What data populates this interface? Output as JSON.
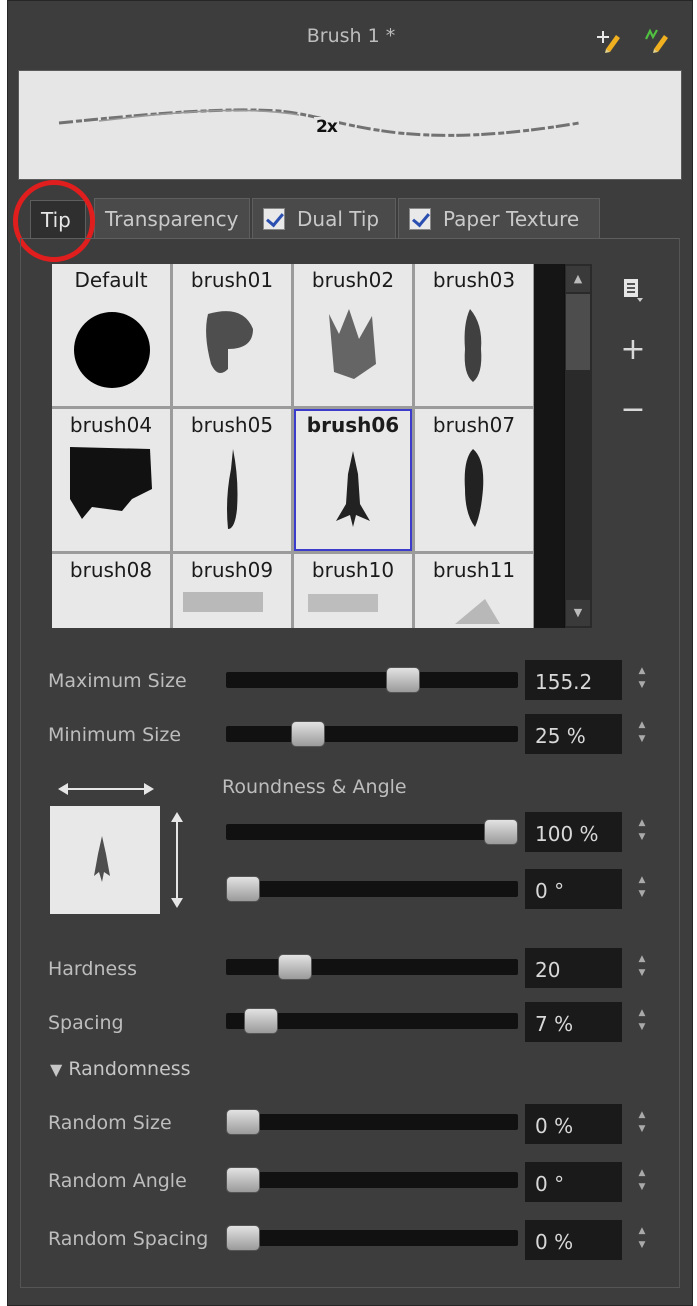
{
  "header": {
    "title": "Brush 1 *",
    "icons": [
      "new-brush-icon",
      "new-brush-variant-icon"
    ]
  },
  "preview": {
    "badge": "2x"
  },
  "tabs": [
    {
      "label": "Tip",
      "active": true
    },
    {
      "label": "Transparency",
      "active": false
    },
    {
      "label": "Dual Tip",
      "checked": true
    },
    {
      "label": "Paper Texture",
      "checked": true
    }
  ],
  "brushes": [
    {
      "name": "Default"
    },
    {
      "name": "brush01"
    },
    {
      "name": "brush02"
    },
    {
      "name": "brush03"
    },
    {
      "name": "brush04"
    },
    {
      "name": "brush05"
    },
    {
      "name": "brush06",
      "selected": true
    },
    {
      "name": "brush07"
    },
    {
      "name": "brush08"
    },
    {
      "name": "brush09"
    },
    {
      "name": "brush10"
    },
    {
      "name": "brush11"
    }
  ],
  "side_buttons": {
    "menu": "menu-icon",
    "add": "+",
    "remove": "−"
  },
  "sliders": {
    "max_size": {
      "label": "Maximum Size",
      "value": "155.2",
      "level": 0.62
    },
    "min_size": {
      "label": "Minimum Size",
      "value": "25 %",
      "level": 0.25
    },
    "roundness": {
      "value": "100 %",
      "level": 1.0
    },
    "angle": {
      "value": "0 °",
      "level": 0.0
    },
    "hardness": {
      "label": "Hardness",
      "value": "20",
      "level": 0.2
    },
    "spacing": {
      "label": "Spacing",
      "value": "7 %",
      "level": 0.07
    },
    "random_size": {
      "label": "Random Size",
      "value": "0 %",
      "level": 0.0
    },
    "random_angle": {
      "label": "Random Angle",
      "value": "0 °",
      "level": 0.0
    },
    "random_spacing": {
      "label": "Random Spacing",
      "value": "0 %",
      "level": 0.0
    }
  },
  "roundness_angle_label": "Roundness & Angle",
  "randomness_label": "Randomness",
  "colors": {
    "panel": "#3d3d3d",
    "selection": "#3b3bcc",
    "highlight_ring": "#e01e1e"
  }
}
